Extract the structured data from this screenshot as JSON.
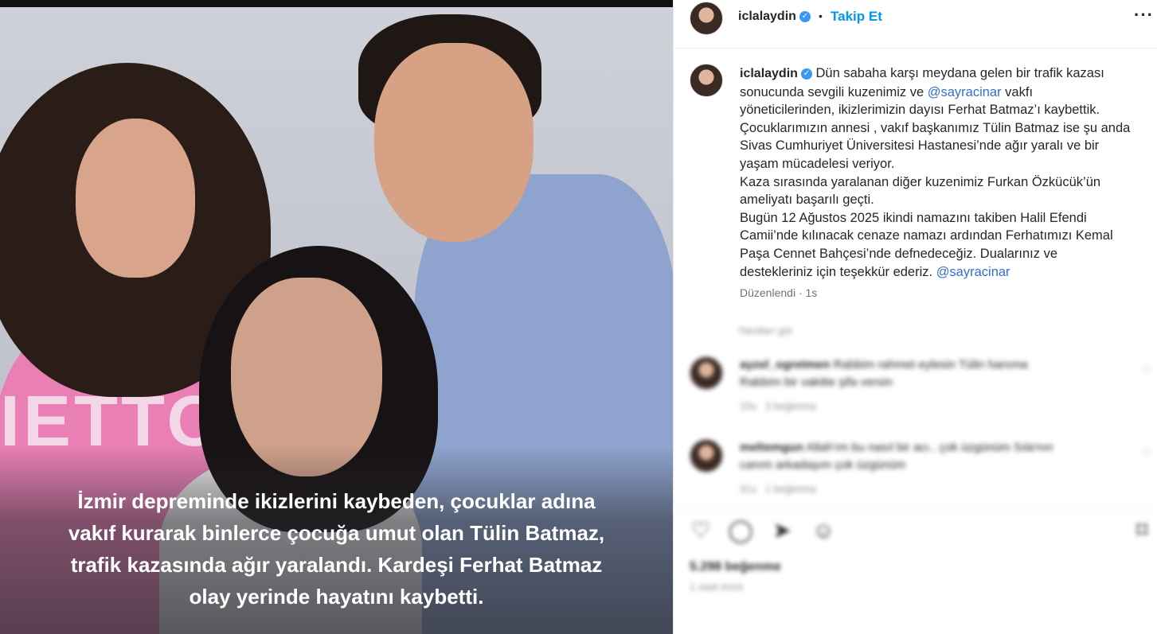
{
  "media": {
    "shirt_print": "IETTO",
    "caption_lines": [
      "İzmir depreminde ikizlerini kaybeden, çocuklar adına",
      "vakıf kurarak binlerce çocuğa umut olan Tülin Batmaz,",
      "trafik kazasında ağır yaralandı. Kardeşi Ferhat Batmaz",
      "olay yerinde hayatını kaybetti."
    ]
  },
  "header": {
    "username": "iclalaydin",
    "separator": "•",
    "follow_label": "Takip Et",
    "more_label": "···"
  },
  "post": {
    "username": "iclalaydin",
    "mention": "@sayracinar",
    "lines": {
      "l1": "Dün sabaha karşı meydana gelen bir trafik kazası",
      "l2a": "sonucunda sevgili kuzenimiz ve ",
      "l2b": " vakfı",
      "l3": "yöneticilerinden, ikizlerimizin dayısı Ferhat Batmaz’ı kaybettik.",
      "l4": "Çocuklarımızın annesi , vakıf başkanımız Tülin Batmaz ise şu anda",
      "l5": "Sivas Cumhuriyet Üniversitesi Hastanesi’nde ağır yaralı ve bir",
      "l6": "yaşam mücadelesi veriyor.",
      "l7": "Kaza sırasında yaralanan diğer kuzenimiz Furkan Özkücük’ün",
      "l8": "ameliyatı başarılı geçti.",
      "l9": "Bugün 12 Ağustos 2025 ikindi namazını takiben Halil Efendi",
      "l10": "Camii’nde kılınacak cenaze namazı ardından Ferhatımızı Kemal",
      "l11": "Paşa Cennet Bahçesi’nde defnedeceğiz. Dualarınız ve",
      "l12": "destekleriniz için teşekkür ederiz. "
    },
    "edited": "Düzenlendi",
    "time": "1s"
  },
  "comments": {
    "replies_header": "Yanıtları gör",
    "items": [
      {
        "user": "ayzel_ogretmen",
        "text1": "Rabbim rahmet eylesin Tülin hanıma",
        "text2": "Rabbim bir vakitte şifa versin",
        "age": "15s",
        "likes": "3 beğenme"
      },
      {
        "user": "meltemgun",
        "text1": "Allah'ım bu nasıl bir acı.. çok üzgünüm Sıla'nın",
        "text2": "canım arkadaşım çok üzgünüm",
        "age": "41s",
        "likes": "1 beğenme"
      }
    ]
  },
  "footer": {
    "likes": "5.298 beğenme",
    "ago": "1 saat önce"
  },
  "icons": [
    "verified-badge-icon",
    "heart-icon",
    "comment-icon",
    "share-icon",
    "emoji-icon",
    "bookmark-icon",
    "more-icon"
  ]
}
